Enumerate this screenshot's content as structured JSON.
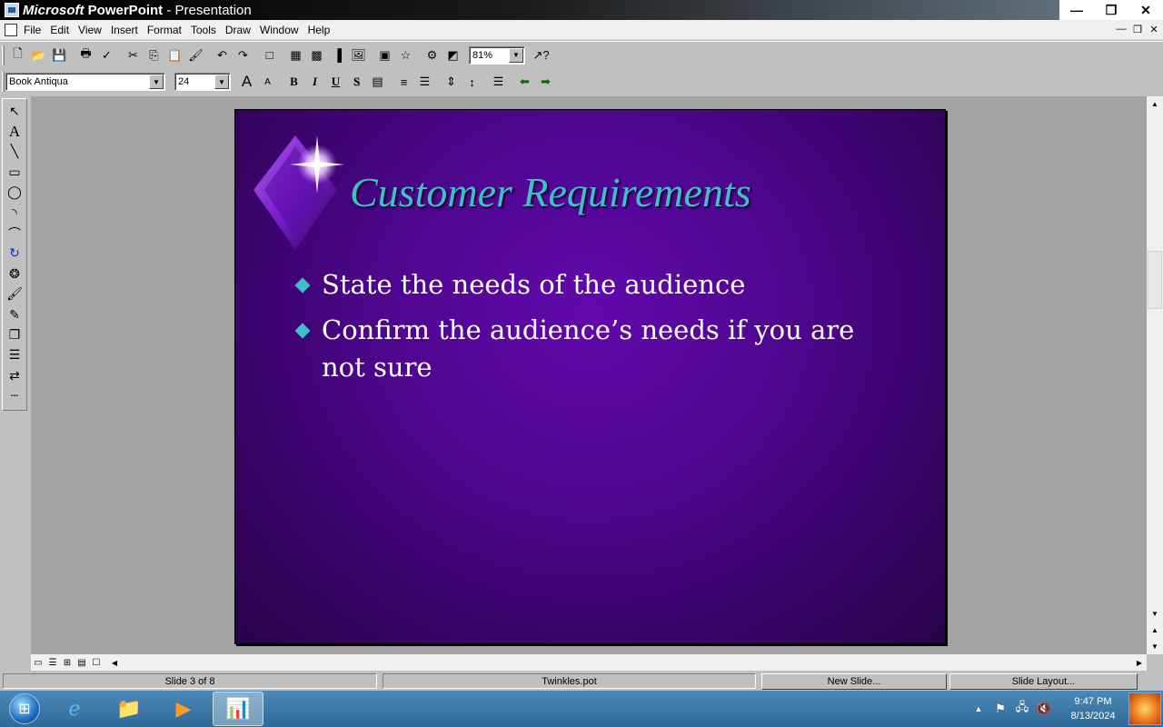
{
  "window": {
    "title_brand": "Microsoft",
    "title_app": "PowerPoint",
    "title_rest": " - Presentation"
  },
  "menu": [
    "File",
    "Edit",
    "View",
    "Insert",
    "Format",
    "Tools",
    "Draw",
    "Window",
    "Help"
  ],
  "toolbar": {
    "zoom": "81%",
    "font_name": "Book Antiqua",
    "font_size": "24",
    "bold_label": "B",
    "italic_label": "I",
    "underline_label": "U",
    "shadow_label": "S",
    "grow_font_label": "A",
    "shrink_font_label": "A"
  },
  "slide": {
    "title": "Customer Requirements",
    "bullets": [
      "State the needs of the audience",
      "Confirm the audience’s needs if you are not sure"
    ],
    "colors": {
      "background": "#4e068e",
      "title": "#3fc0c6",
      "bullet": "#3fc0c6",
      "text": "#ffffff"
    }
  },
  "status": {
    "slide_indicator": "Slide 3 of 8",
    "template": "Twinkles.pot",
    "new_slide": "New Slide...",
    "slide_layout": "Slide Layout..."
  },
  "taskbar": {
    "time": "9:47 PM",
    "date": "8/13/2024"
  }
}
